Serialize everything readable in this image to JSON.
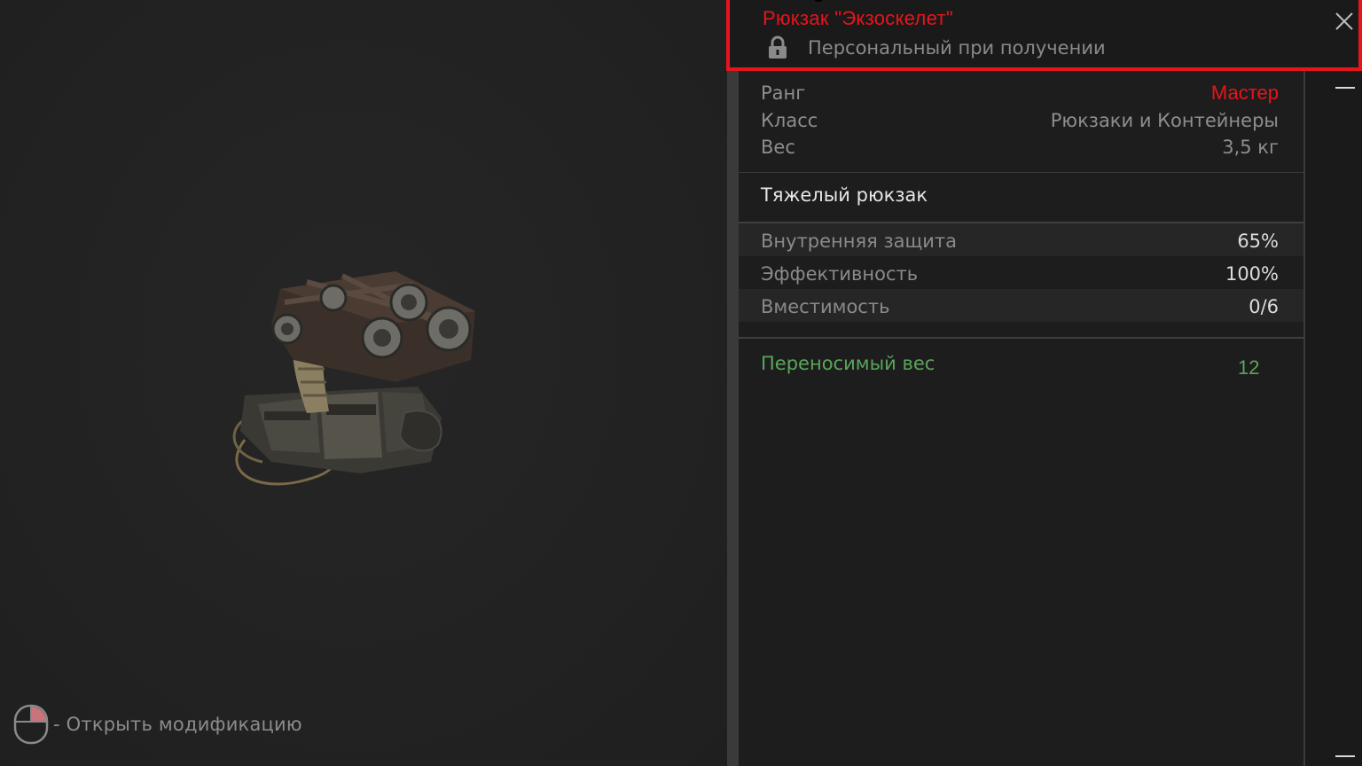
{
  "header": {
    "title": "Рюкзак \"Экзоскелет\"",
    "binding": "Персональный при получении",
    "lock_icon": "lock-icon",
    "close_icon": "close-icon"
  },
  "info": {
    "rank_label": "Ранг",
    "rank_value": "Мастер",
    "class_label": "Класс",
    "class_value": "Рюкзаки и Контейнеры",
    "weight_label": "Вес",
    "weight_value": "3,5 кг"
  },
  "subtype": "Тяжелый рюкзак",
  "stats": [
    {
      "label": "Внутренняя защита",
      "value": "65%"
    },
    {
      "label": "Эффективность",
      "value": "100%"
    },
    {
      "label": "Вместимость",
      "value": "0/6"
    }
  ],
  "bonus": {
    "label": "Переносимый вес",
    "value": "12"
  },
  "hint": {
    "text": "- Открыть модификацию",
    "icon": "mouse-icon"
  },
  "colors": {
    "accent_red": "#e8141b",
    "bonus_green": "#5aa55a",
    "panel_bg": "#1d1d1d",
    "viewer_bg": "#232323"
  }
}
